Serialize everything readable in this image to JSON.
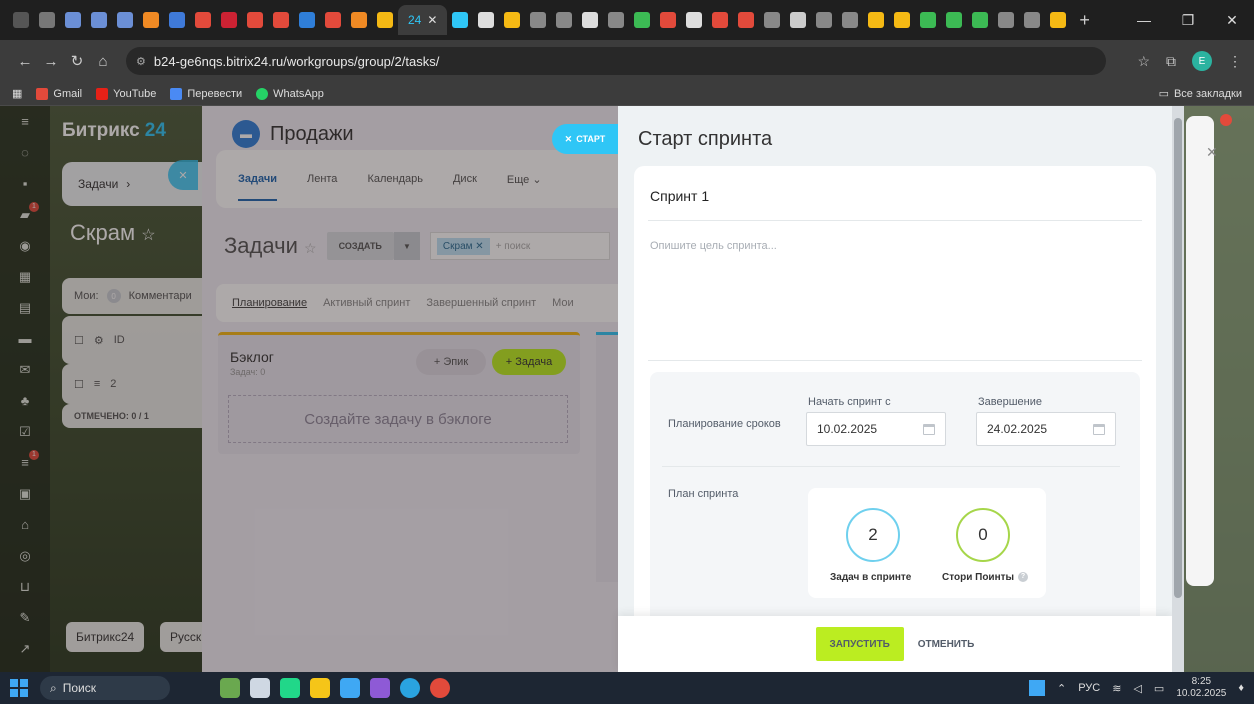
{
  "browser": {
    "active_tab_label": "24",
    "url": "b24-ge6nqs.bitrix24.ru/workgroups/group/2/tasks/",
    "profile_initial": "E",
    "bookmarks": [
      "Gmail",
      "YouTube",
      "Перевести",
      "WhatsApp"
    ],
    "all_bookmarks": "Все закладки"
  },
  "bitrix": {
    "logo_text": "Битрикс",
    "logo_num": "24",
    "breadcrumb": "Задачи",
    "scrum_title": "Скрам",
    "my_label": "Мои:",
    "comments_label": "Комментари",
    "comments_count": "0",
    "id_header": "ID",
    "row_id": "2",
    "marked": "ОТМЕЧЕНО: 0 / 1",
    "footer_brand": "Битрикс24",
    "footer_lang": "Русск",
    "nav_badges": [
      "1",
      "1"
    ]
  },
  "project": {
    "title": "Продажи",
    "tabs": [
      "Задачи",
      "Лента",
      "Календарь",
      "Диск",
      "Еще"
    ],
    "tasks_heading": "Задачи",
    "create_label": "СОЗДАТЬ",
    "filter_tag": "Скрам",
    "filter_placeholder": "+ поиск",
    "sub_tabs": [
      "Планирование",
      "Активный спринт",
      "Завершенный спринт",
      "Мои"
    ],
    "backlog_title": "Бэклог",
    "backlog_sub": "Задач: 0",
    "epic_btn": "+ Эпик",
    "task_btn": "+ Задача",
    "dropzone": "Создайте задачу в бэклоге",
    "close_label": "СТАРТ"
  },
  "sprint_dialog": {
    "title": "Старт спринта",
    "sprint_name": "Спринт 1",
    "goal_placeholder": "Опишите цель спринта...",
    "planning_label": "Планирование сроков",
    "start_label": "Начать спринт с",
    "start_value": "10.02.2025",
    "end_label": "Завершение",
    "end_value": "24.02.2025",
    "plan_label": "План спринта",
    "tasks_count": "2",
    "tasks_label": "Задач в спринте",
    "points_count": "0",
    "points_label": "Стори Поинты",
    "run_btn": "ЗАПУСТИТЬ",
    "cancel_btn": "ОТМЕНИТЬ"
  },
  "taskbar": {
    "search": "Поиск",
    "lang": "РУС",
    "time": "8:25",
    "date": "10.02.2025"
  }
}
